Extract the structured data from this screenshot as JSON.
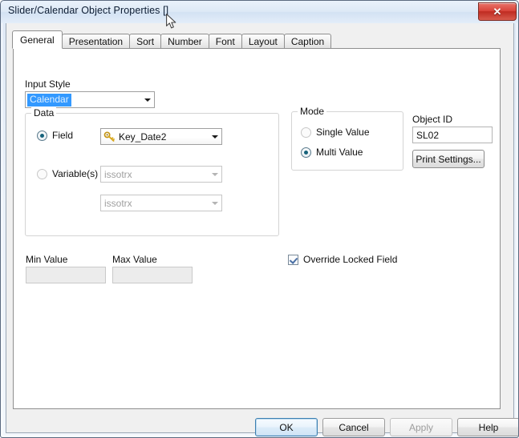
{
  "window": {
    "title": "Slider/Calendar Object Properties []",
    "close_glyph": "✕",
    "close_icon_name": "close-icon"
  },
  "tabs": [
    {
      "label": "General",
      "active": true
    },
    {
      "label": "Presentation",
      "active": false
    },
    {
      "label": "Sort",
      "active": false
    },
    {
      "label": "Number",
      "active": false
    },
    {
      "label": "Font",
      "active": false
    },
    {
      "label": "Layout",
      "active": false
    },
    {
      "label": "Caption",
      "active": false
    }
  ],
  "general": {
    "input_style": {
      "label": "Input Style",
      "value": "Calendar",
      "selected": true
    },
    "data_group": {
      "title": "Data",
      "field_radio": {
        "label": "Field",
        "checked": true
      },
      "field_combo": {
        "value": "Key_Date2",
        "icon": "key-icon"
      },
      "variables_radio": {
        "label": "Variable(s)",
        "checked": false
      },
      "variable_combo_1": {
        "value": "issotrx",
        "disabled": true
      },
      "variable_combo_2": {
        "value": "issotrx",
        "disabled": true
      }
    },
    "mode_group": {
      "title": "Mode",
      "single_value": {
        "label": "Single Value",
        "checked": false
      },
      "multi_value": {
        "label": "Multi Value",
        "checked": true
      }
    },
    "object_id": {
      "label": "Object ID",
      "value": "SL02"
    },
    "print_settings_button": "Print Settings...",
    "min_value": {
      "label": "Min Value",
      "value": "",
      "disabled": true
    },
    "max_value": {
      "label": "Max Value",
      "value": "",
      "disabled": true
    },
    "override_locked_field": {
      "label": "Override Locked Field",
      "checked": true
    }
  },
  "footer": {
    "ok": "OK",
    "cancel": "Cancel",
    "apply": "Apply",
    "help": "Help"
  },
  "colors": {
    "selection_blue": "#3399ff",
    "close_red": "#c9372b",
    "default_button_border": "#3c7fb1",
    "key_icon_gold": "#d9a81f"
  }
}
